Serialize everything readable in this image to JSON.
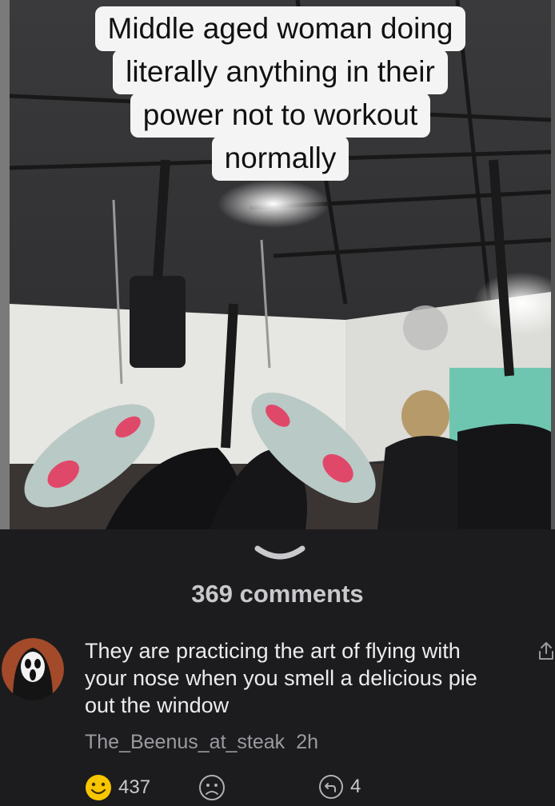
{
  "media": {
    "caption_lines": [
      "Middle aged woman doing",
      "literally anything in their",
      "power not to workout",
      "normally"
    ]
  },
  "comments_header": "369 comments",
  "comment": {
    "text": "They are practicing the art of flying with your nose when you smell a delicious pie out the window",
    "author": "The_Beenus_at_steak",
    "time": "2h",
    "likes": "437",
    "replies": "4"
  },
  "colors": {
    "background": "#1c1c1e",
    "text": "#ececef",
    "muted": "#9a9aa0",
    "caption_bg": "#f4f4f4",
    "emoji_yellow": "#f7c600"
  },
  "icons": [
    "chevron-down-icon",
    "share-icon",
    "happy-face-icon",
    "sad-face-icon",
    "reply-icon"
  ]
}
